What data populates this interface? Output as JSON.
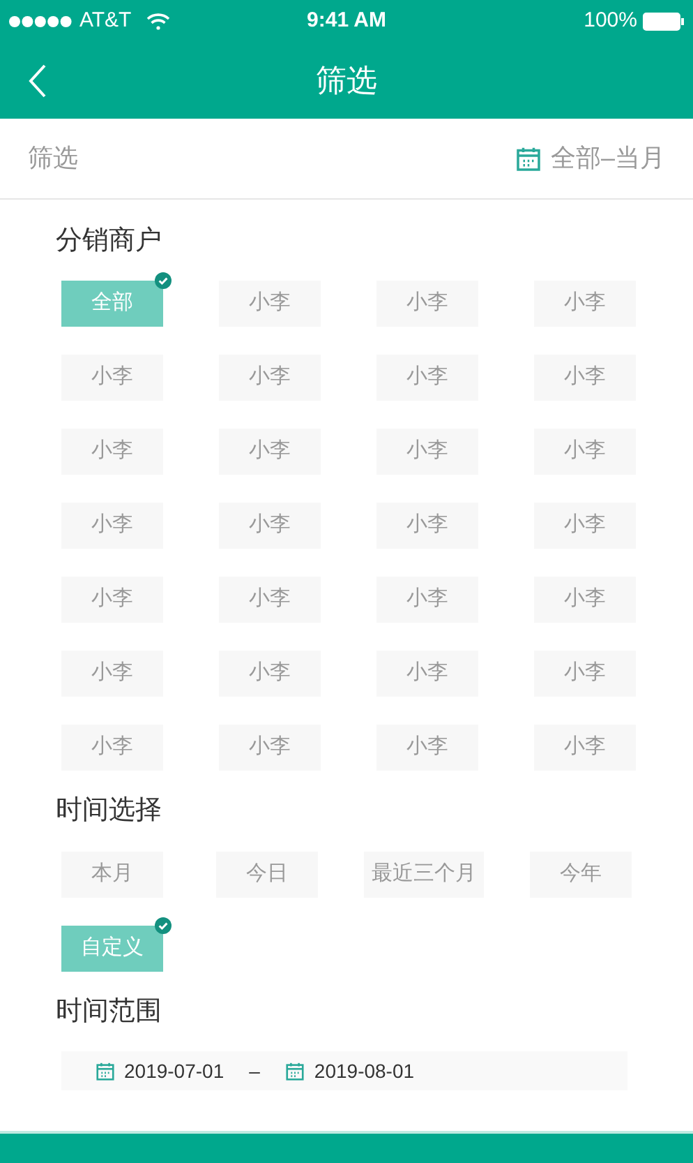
{
  "status_bar": {
    "carrier": "AT&T",
    "time": "9:41 AM",
    "battery": "100%"
  },
  "header": {
    "title": "筛选"
  },
  "filter_bar": {
    "label": "筛选",
    "range": "全部–当月"
  },
  "distributors": {
    "title": "分销商户",
    "options": [
      {
        "label": "全部",
        "selected": true
      },
      {
        "label": "小李",
        "selected": false
      },
      {
        "label": "小李",
        "selected": false
      },
      {
        "label": "小李",
        "selected": false
      },
      {
        "label": "小李",
        "selected": false
      },
      {
        "label": "小李",
        "selected": false
      },
      {
        "label": "小李",
        "selected": false
      },
      {
        "label": "小李",
        "selected": false
      },
      {
        "label": "小李",
        "selected": false
      },
      {
        "label": "小李",
        "selected": false
      },
      {
        "label": "小李",
        "selected": false
      },
      {
        "label": "小李",
        "selected": false
      },
      {
        "label": "小李",
        "selected": false
      },
      {
        "label": "小李",
        "selected": false
      },
      {
        "label": "小李",
        "selected": false
      },
      {
        "label": "小李",
        "selected": false
      },
      {
        "label": "小李",
        "selected": false
      },
      {
        "label": "小李",
        "selected": false
      },
      {
        "label": "小李",
        "selected": false
      },
      {
        "label": "小李",
        "selected": false
      },
      {
        "label": "小李",
        "selected": false
      },
      {
        "label": "小李",
        "selected": false
      },
      {
        "label": "小李",
        "selected": false
      },
      {
        "label": "小李",
        "selected": false
      },
      {
        "label": "小李",
        "selected": false
      },
      {
        "label": "小李",
        "selected": false
      },
      {
        "label": "小李",
        "selected": false
      },
      {
        "label": "小李",
        "selected": false
      }
    ]
  },
  "time_select": {
    "title": "时间选择",
    "options": [
      {
        "label": "本月",
        "selected": false
      },
      {
        "label": "今日",
        "selected": false
      },
      {
        "label": "最近三个月",
        "selected": false
      },
      {
        "label": "今年",
        "selected": false
      },
      {
        "label": "自定义",
        "selected": true
      }
    ]
  },
  "time_range": {
    "title": "时间范围",
    "start": "2019-07-01",
    "separator": "–",
    "end": "2019-08-01"
  }
}
